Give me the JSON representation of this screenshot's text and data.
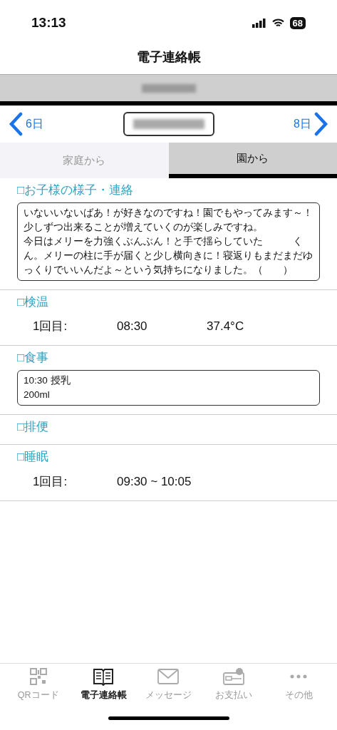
{
  "status_bar": {
    "time": "13:13",
    "battery": "68"
  },
  "title": "電子連絡帳",
  "date_nav": {
    "prev": "6日",
    "next": "8日"
  },
  "tabs": [
    {
      "label": "家庭から",
      "selected": false
    },
    {
      "label": "園から",
      "selected": true
    }
  ],
  "sections": [
    {
      "kind": "note",
      "heading": "□お子様の様子・連絡",
      "lines": [
        "いないいないばあ！が好きなのですね！園でもやってみます～！",
        "少しずつ出来ることが増えていくのが楽しみですね。",
        "今日はメリーを力強くぶんぶん！と手で揺らしていた　　　くん。メリーの柱に手が届くと少し横向きに！寝返りもまだまだゆっくりでいいんだよ～という気持ちになりました。（　　）"
      ]
    },
    {
      "kind": "rows",
      "heading": "□検温",
      "rows": [
        {
          "label": "1回目:",
          "time": "08:30",
          "value": "37.4°C"
        }
      ]
    },
    {
      "kind": "note",
      "heading": "□食事",
      "lines": [
        "10:30 授乳",
        "200ml"
      ]
    },
    {
      "kind": "empty",
      "heading": "□排便"
    },
    {
      "kind": "rows",
      "heading": "□睡眠",
      "rows": [
        {
          "label": "1回目:",
          "time": "09:30 ~ 10:05"
        }
      ]
    }
  ],
  "tab_bar": [
    {
      "label": "QRコード",
      "kind": "qr",
      "selected": false
    },
    {
      "label": "電子連絡帳",
      "kind": "book",
      "selected": true
    },
    {
      "label": "メッセージ",
      "kind": "mail",
      "selected": false
    },
    {
      "label": "お支払い",
      "kind": "wallet",
      "selected": false
    },
    {
      "label": "その他",
      "kind": "more",
      "selected": false
    }
  ]
}
